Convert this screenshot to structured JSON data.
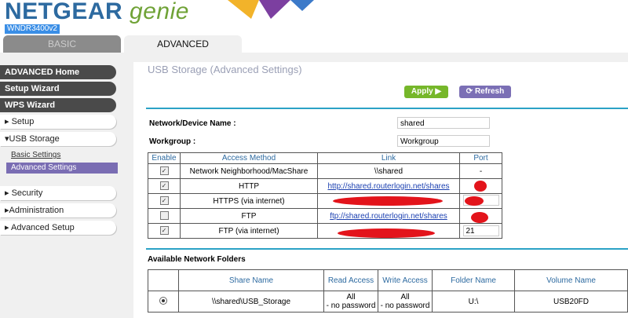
{
  "header": {
    "logo_main": "NETGEAR",
    "logo_genie": "genie",
    "model": "WNDR3400v2"
  },
  "tabs": [
    {
      "label": "BASIC"
    },
    {
      "label": "ADVANCED"
    }
  ],
  "sidebar": {
    "items": [
      {
        "label": "ADVANCED Home"
      },
      {
        "label": "Setup Wizard"
      },
      {
        "label": "WPS Wizard"
      },
      {
        "label": "Setup"
      },
      {
        "label": "USB Storage"
      },
      {
        "label": "Basic Settings"
      },
      {
        "label": "Advanced Settings"
      },
      {
        "label": "Security"
      },
      {
        "label": "Administration"
      },
      {
        "label": "Advanced Setup"
      }
    ]
  },
  "main": {
    "title": "USB Storage (Advanced Settings)",
    "apply_label": "Apply ▶",
    "refresh_label": "Refresh",
    "device_name_label": "Network/Device Name :",
    "device_name_value": "shared",
    "workgroup_label": "Workgroup :",
    "workgroup_value": "Workgroup"
  },
  "access_table": {
    "headers": [
      "Enable",
      "Access Method",
      "Link",
      "Port"
    ],
    "rows": [
      {
        "enabled": true,
        "method": "Network Neighborhood/MacShare",
        "link": "\\\\shared",
        "port": "-"
      },
      {
        "enabled": true,
        "method": "HTTP",
        "link": "http://shared.routerlogin.net/shares",
        "port": ""
      },
      {
        "enabled": true,
        "method": "HTTPS (via internet)",
        "link": "",
        "port": ""
      },
      {
        "enabled": false,
        "method": "FTP",
        "link": "ftp://shared.routerlogin.net/shares",
        "port": ""
      },
      {
        "enabled": true,
        "method": "FTP (via internet)",
        "link": "",
        "port": "21"
      }
    ]
  },
  "folders": {
    "title": "Available Network Folders",
    "headers": [
      "Share Name",
      "Read Access",
      "Write Access",
      "Folder Name",
      "Volume Name"
    ],
    "rows": [
      {
        "share": "\\\\shared\\USB_Storage",
        "read": "All\n- no password",
        "write": "All\n- no password",
        "folder": "U:\\",
        "volume": "USB20FD"
      }
    ]
  },
  "colors": {
    "brand_blue": "#2d6aa0",
    "genie_green": "#6fa236",
    "apply_green": "#76b72a",
    "refresh_purple": "#7b6fb5",
    "rule_blue": "#2ba2c6",
    "redaction_red": "#e3141b"
  }
}
